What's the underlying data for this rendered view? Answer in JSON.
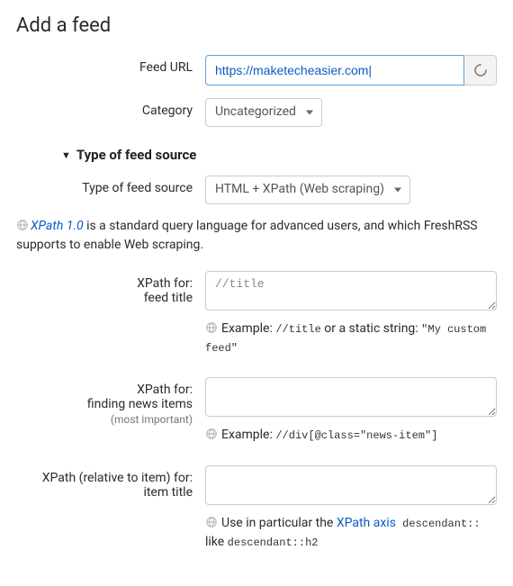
{
  "page": {
    "title": "Add a feed"
  },
  "feed_url": {
    "label": "Feed URL",
    "value": "https://maketecheasier.com|"
  },
  "category": {
    "label": "Category",
    "selected": "Uncategorized"
  },
  "source_section": {
    "header": "Type of feed source",
    "type_label": "Type of feed source",
    "type_selected": "HTML + XPath (Web scraping)"
  },
  "xpath_intro": {
    "link_text": "XPath 1.0",
    "text_before": " is a standard query language for advanced users, and which FreshRSS supports to enable Web scraping."
  },
  "fields": {
    "feed_title": {
      "label_line1": "XPath for:",
      "label_line2": "feed title",
      "value": "//title",
      "hint_prefix": "Example: ",
      "hint_code1": "//title",
      "hint_mid": " or a static string: ",
      "hint_code2": "\"My custom feed\""
    },
    "items": {
      "label_line1": "XPath for:",
      "label_line2": "finding news items",
      "label_sub": "(most important)",
      "value": "",
      "hint_prefix": "Example: ",
      "hint_code": "//div[@class=\"news-item\"]"
    },
    "item_title": {
      "label_line1": "XPath (relative to item) for:",
      "label_line2": "item title",
      "value": "",
      "hint_prefix": "Use in particular the ",
      "hint_link": "XPath axis",
      "hint_code1": " descendant::",
      "hint_mid": " like ",
      "hint_code2": "descendant::h2"
    }
  }
}
